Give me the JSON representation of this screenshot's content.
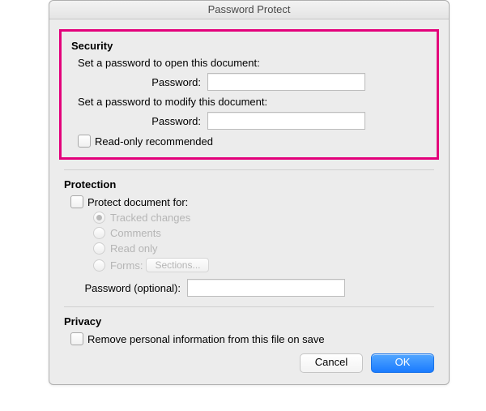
{
  "window": {
    "title": "Password Protect"
  },
  "security": {
    "heading": "Security",
    "open_prompt": "Set a password to open this document:",
    "open_label": "Password:",
    "open_value": "",
    "modify_prompt": "Set a password to modify this document:",
    "modify_label": "Password:",
    "modify_value": "",
    "readonly_label": "Read-only recommended"
  },
  "protection": {
    "heading": "Protection",
    "protect_for_label": "Protect document for:",
    "radios": {
      "tracked": "Tracked changes",
      "comments": "Comments",
      "readonly": "Read only",
      "forms": "Forms:"
    },
    "sections_button": "Sections...",
    "password_label": "Password (optional):",
    "password_value": ""
  },
  "privacy": {
    "heading": "Privacy",
    "remove_label": "Remove personal information from this file on save"
  },
  "buttons": {
    "cancel": "Cancel",
    "ok": "OK"
  }
}
